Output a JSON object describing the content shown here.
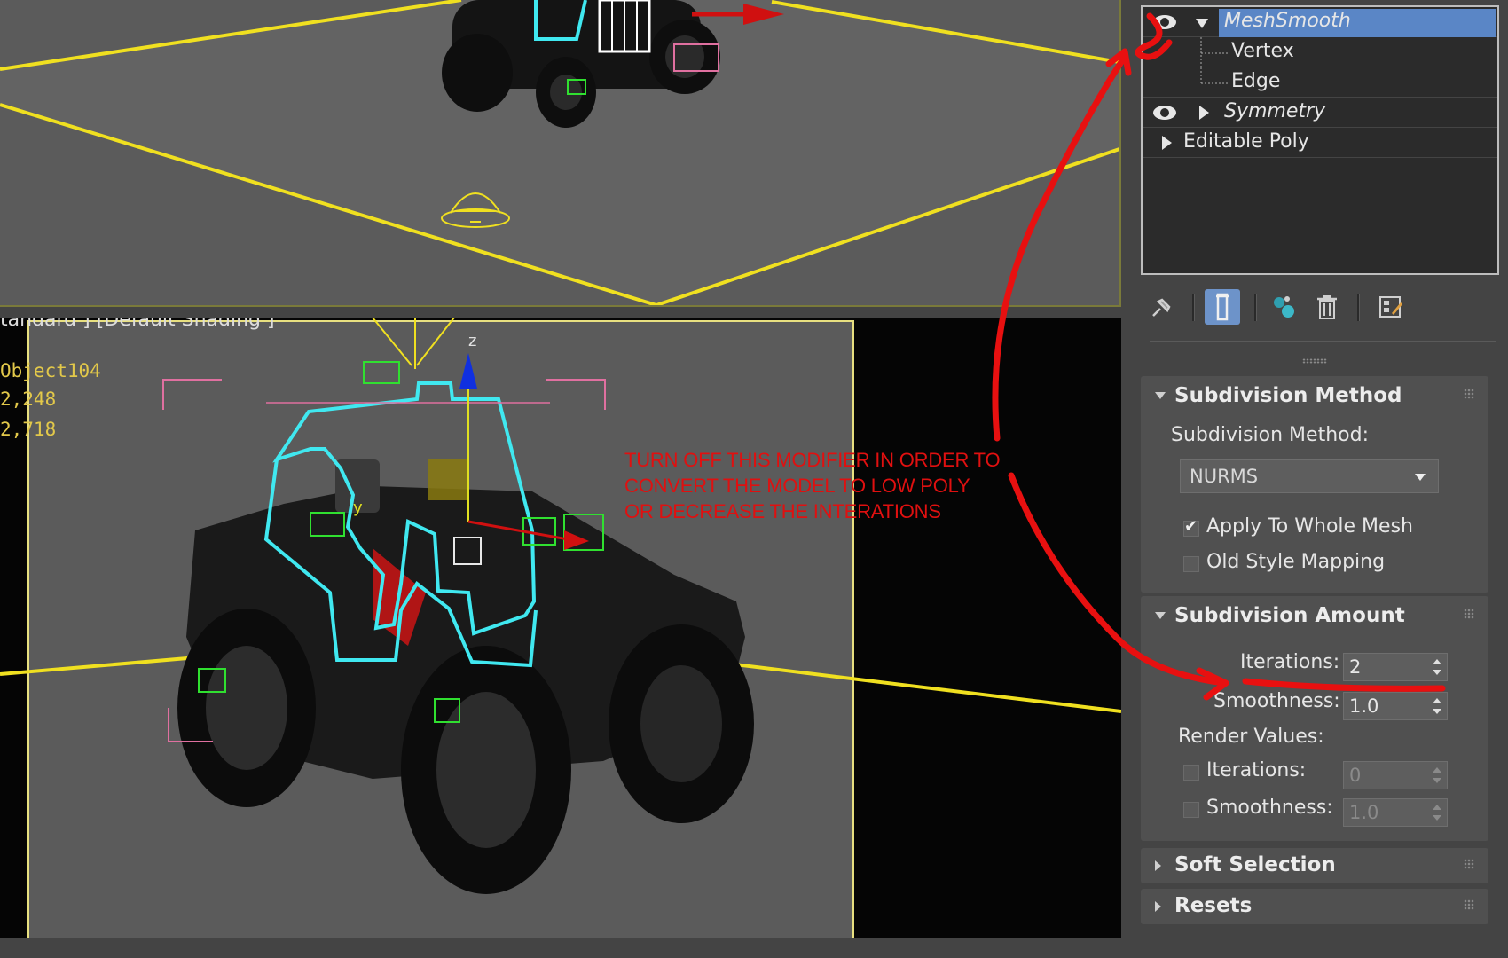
{
  "viewport_bottom": {
    "label": "tandard ] [Default Shading ]",
    "stats": [
      "Object104",
      "2,248",
      "2,718"
    ],
    "axis_z": "z",
    "axis_y": "y"
  },
  "annotation": {
    "lines": [
      "TURN OFF THIS MODIFIER IN ORDER TO",
      "CONVERT THE MODEL TO LOW POLY",
      "OR DECREASE THE INTERATIONS"
    ]
  },
  "modifier_stack": {
    "items": [
      {
        "label": "MeshSmooth",
        "selected": true,
        "visible": true
      },
      {
        "label": "Vertex"
      },
      {
        "label": "Edge"
      },
      {
        "label": "Symmetry",
        "visible": true
      },
      {
        "label": "Editable Poly"
      }
    ]
  },
  "toolbar": {
    "icons": [
      "pin-stack-icon",
      "show-end-result-icon",
      "make-unique-icon",
      "remove-modifier-icon",
      "configure-modifier-sets-icon"
    ]
  },
  "subdivision_method": {
    "title": "Subdivision Method",
    "method_label": "Subdivision Method:",
    "method_value": "NURMS",
    "apply_whole_mesh": "Apply To Whole Mesh",
    "apply_whole_mesh_checked": true,
    "old_style_mapping": "Old Style Mapping",
    "old_style_mapping_checked": false
  },
  "subdivision_amount": {
    "title": "Subdivision Amount",
    "iterations_label": "Iterations:",
    "iterations_value": "2",
    "smoothness_label": "Smoothness:",
    "smoothness_value": "1.0",
    "render_values_label": "Render Values:",
    "render_iterations_label": "Iterations:",
    "render_iterations_value": "0",
    "render_smoothness_label": "Smoothness:",
    "render_smoothness_value": "1.0"
  },
  "soft_selection": {
    "title": "Soft Selection"
  },
  "resets": {
    "title": "Resets"
  },
  "colors": {
    "selection": "#5a86c6",
    "annotation_red": "#e01010",
    "grid_yellow": "#f0e020",
    "wire_cyan": "#40e8f0"
  }
}
